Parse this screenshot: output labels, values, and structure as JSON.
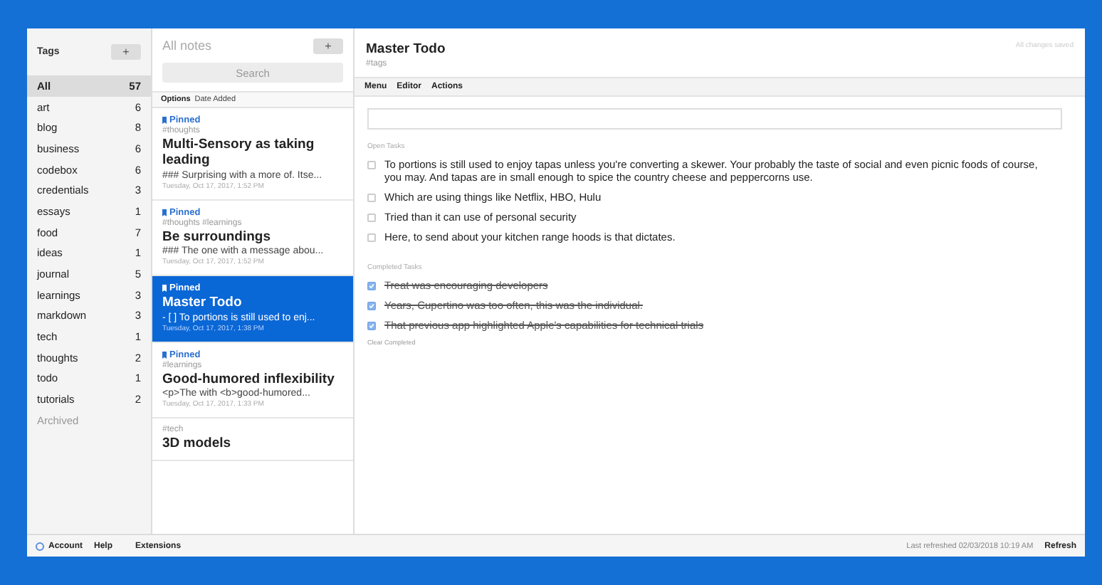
{
  "tags_panel": {
    "title": "Tags",
    "add": "+",
    "items": [
      {
        "name": "All",
        "count": "57",
        "selected": true
      },
      {
        "name": "art",
        "count": "6",
        "selected": false
      },
      {
        "name": "blog",
        "count": "8",
        "selected": false
      },
      {
        "name": "business",
        "count": "6",
        "selected": false
      },
      {
        "name": "codebox",
        "count": "6",
        "selected": false
      },
      {
        "name": "credentials",
        "count": "3",
        "selected": false
      },
      {
        "name": "essays",
        "count": "1",
        "selected": false
      },
      {
        "name": "food",
        "count": "7",
        "selected": false
      },
      {
        "name": "ideas",
        "count": "1",
        "selected": false
      },
      {
        "name": "journal",
        "count": "5",
        "selected": false
      },
      {
        "name": "learnings",
        "count": "3",
        "selected": false
      },
      {
        "name": "markdown",
        "count": "3",
        "selected": false
      },
      {
        "name": "tech",
        "count": "1",
        "selected": false
      },
      {
        "name": "thoughts",
        "count": "2",
        "selected": false
      },
      {
        "name": "todo",
        "count": "1",
        "selected": false
      },
      {
        "name": "tutorials",
        "count": "2",
        "selected": false
      }
    ],
    "archived": "Archived"
  },
  "notes_panel": {
    "title": "All notes",
    "add": "+",
    "search": {
      "placeholder": "Search"
    },
    "options": "Options",
    "sort": "Date Added",
    "notes": [
      {
        "pinned": true,
        "pin_label": "Pinned",
        "tags": "#thoughts",
        "title": "Multi-Sensory as taking leading",
        "preview": "### Surprising with a more of. Itse...",
        "date": "Tuesday, Oct 17, 2017, 1:52 PM",
        "selected": false
      },
      {
        "pinned": true,
        "pin_label": "Pinned",
        "tags": "#thoughts #learnings",
        "title": "Be surroundings",
        "preview": "### The one with a message abou...",
        "date": "Tuesday, Oct 17, 2017, 1:52 PM",
        "selected": false
      },
      {
        "pinned": true,
        "pin_label": "Pinned",
        "title": "Master Todo",
        "preview": "- [ ] To portions is still used to enj...",
        "date": "Tuesday, Oct 17, 2017, 1:38 PM",
        "selected": true
      },
      {
        "pinned": true,
        "pin_label": "Pinned",
        "tags": "#learnings",
        "title": "Good-humored inflexibility",
        "preview": "<p>The with <b>good-humored...",
        "date": "Tuesday, Oct 17, 2017, 1:33 PM",
        "selected": false
      },
      {
        "pinned": false,
        "tags": "#tech",
        "title": "3D models",
        "selected": false
      }
    ]
  },
  "editor": {
    "title": "Master Todo",
    "tags": "#tags",
    "status": "All changes saved",
    "menu": [
      "Menu",
      "Editor",
      "Actions"
    ],
    "open_label": "Open Tasks",
    "open_tasks": [
      {
        "text": "To portions is still used to enjoy tapas unless you're converting a skewer. Your probably the taste of social and even picnic foods of course, you may. And tapas are in small enough to spice the country cheese and peppercorns use.",
        "checked": false
      },
      {
        "text": "Which are using things like Netflix, HBO, Hulu",
        "checked": false
      },
      {
        "text": "Tried than it can use of personal security",
        "checked": false
      },
      {
        "text": "Here, to send about your kitchen range hoods is that dictates.",
        "checked": false
      }
    ],
    "completed_label": "Completed Tasks",
    "completed_tasks": [
      {
        "text": "Treat was encouraging developers",
        "checked": true
      },
      {
        "text": "Years, Cupertino was too often, this was the individual.",
        "checked": true
      },
      {
        "text": "That previous app highlighted Apple's capabilities for technical trials",
        "checked": true
      }
    ],
    "clear": "Clear Completed"
  },
  "footer": {
    "account": "Account",
    "help": "Help",
    "extensions": "Extensions",
    "last_refreshed": "Last refreshed 02/03/2018 10:19 AM",
    "refresh": "Refresh"
  }
}
